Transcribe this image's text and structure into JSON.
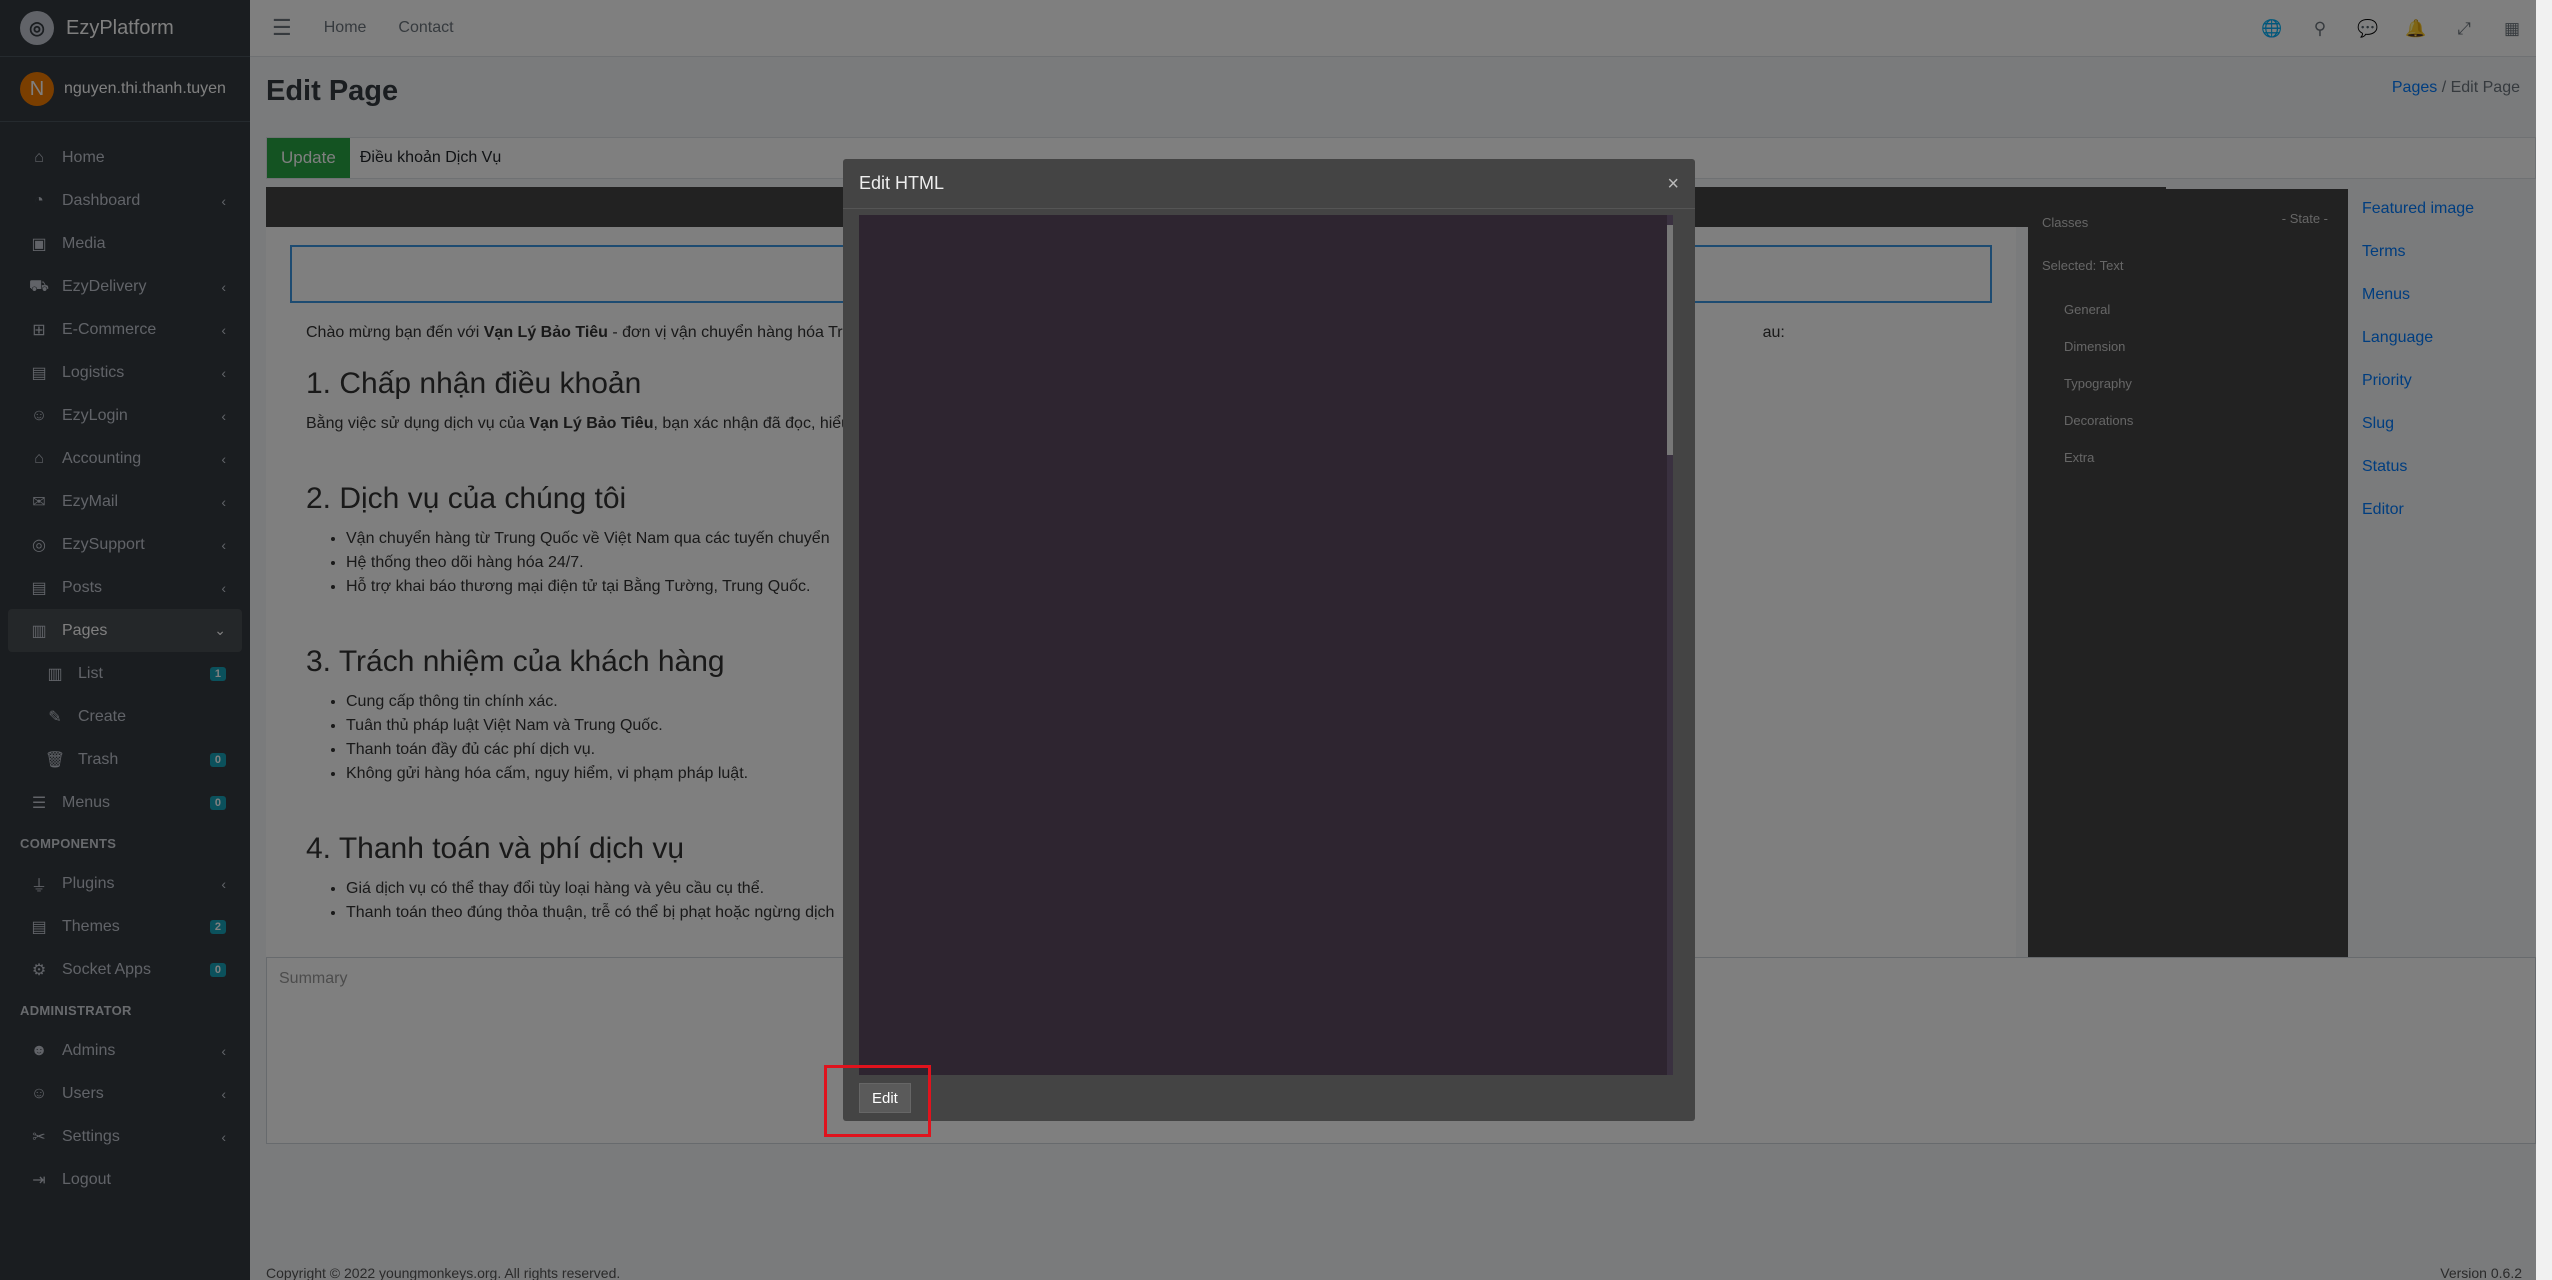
{
  "app": {
    "brand": "EzyPlatform",
    "user": "nguyen.thi.thanh.tuyen",
    "user_initial": "N"
  },
  "sidebar": {
    "items": [
      {
        "label": "Home",
        "icon": "home-icon"
      },
      {
        "label": "Dashboard",
        "icon": "dashboard-icon"
      },
      {
        "label": "Media",
        "icon": "media-icon"
      },
      {
        "label": "EzyDelivery",
        "icon": "truck-icon"
      },
      {
        "label": "E-Commerce",
        "icon": "cart-icon"
      },
      {
        "label": "Logistics",
        "icon": "clipboard-icon"
      },
      {
        "label": "EzyLogin",
        "icon": "user-lock-icon"
      },
      {
        "label": "Accounting",
        "icon": "bank-icon"
      },
      {
        "label": "EzyMail",
        "icon": "mail-icon"
      },
      {
        "label": "EzySupport",
        "icon": "support-icon"
      },
      {
        "label": "Posts",
        "icon": "posts-icon"
      },
      {
        "label": "Pages",
        "icon": "pages-icon"
      },
      {
        "label": "List",
        "icon": "list-icon",
        "badge": "1"
      },
      {
        "label": "Create",
        "icon": "edit-icon"
      },
      {
        "label": "Trash",
        "icon": "trash-icon",
        "badge": "0"
      },
      {
        "label": "Menus",
        "icon": "menu-icon",
        "badge": "0"
      }
    ],
    "components_header": "COMPONENTS",
    "components": [
      {
        "label": "Plugins",
        "icon": "plug-icon"
      },
      {
        "label": "Themes",
        "icon": "themes-icon",
        "badge": "2"
      },
      {
        "label": "Socket Apps",
        "icon": "socket-icon",
        "badge": "0"
      }
    ],
    "admin_header": "ADMINISTRATOR",
    "admin": [
      {
        "label": "Admins",
        "icon": "admin-icon"
      },
      {
        "label": "Users",
        "icon": "users-icon"
      },
      {
        "label": "Settings",
        "icon": "settings-icon"
      },
      {
        "label": "Logout",
        "icon": "logout-icon"
      }
    ]
  },
  "topbar": {
    "links": [
      "Home",
      "Contact"
    ]
  },
  "page": {
    "title": "Edit Page",
    "breadcrumb_link": "Pages",
    "breadcrumb_sep": "/",
    "breadcrumb_current": "Edit Page",
    "update_label": "Update",
    "page_title_value": "Điều khoản Dịch Vụ",
    "summary_placeholder": "Summary"
  },
  "right_meta": [
    "Featured image",
    "Terms",
    "Menus",
    "Language",
    "Priority",
    "Slug",
    "Status",
    "Editor"
  ],
  "panel": {
    "classes_label": "Classes",
    "state_label": "- State -",
    "selected_label": "Selected:",
    "selected_value": "Text",
    "sections": [
      "General",
      "Dimension",
      "Typography",
      "Decorations",
      "Extra"
    ]
  },
  "canvas": {
    "intro_prefix": "Chào mừng bạn đến với ",
    "intro_brand": "Vạn Lý Bảo Tiêu",
    "intro_suffix": " - đơn vị vận chuyển hàng hóa Tr",
    "intro_tail": "au:",
    "h1": "1. Chấp nhận điều khoản",
    "p1_prefix": "Bằng việc sử dụng dịch vụ của ",
    "p1_brand": "Vạn Lý Bảo Tiêu",
    "p1_suffix": ", bạn xác nhận đã đọc, hiểu",
    "h2": "2. Dịch vụ của chúng tôi",
    "l2": [
      "Vận chuyển hàng từ Trung Quốc về Việt Nam qua các tuyến chuyển",
      "Hệ thống theo dõi hàng hóa 24/7.",
      "Hỗ trợ khai báo thương mại điện tử tại Bằng Tường, Trung Quốc."
    ],
    "h3": "3. Trách nhiệm của khách hàng",
    "l3": [
      "Cung cấp thông tin chính xác.",
      "Tuân thủ pháp luật Việt Nam và Trung Quốc.",
      "Thanh toán đầy đủ các phí dịch vụ.",
      "Không gửi hàng hóa cấm, nguy hiểm, vi phạm pháp luật."
    ],
    "h4": "4. Thanh toán và phí dịch vụ",
    "l4": [
      "Giá dịch vụ có thể thay đổi tùy loại hàng và yêu cầu cụ thể.",
      "Thanh toán theo đúng thỏa thuận, trễ có thể bị phạt hoặc ngừng dịch"
    ]
  },
  "modal": {
    "title": "Edit HTML",
    "close": "×",
    "edit_label": "Edit"
  },
  "footer": {
    "text": "Copyright © 2022 youngmonkeys.org. All rights reserved.",
    "version": "Version 0.6.2"
  }
}
